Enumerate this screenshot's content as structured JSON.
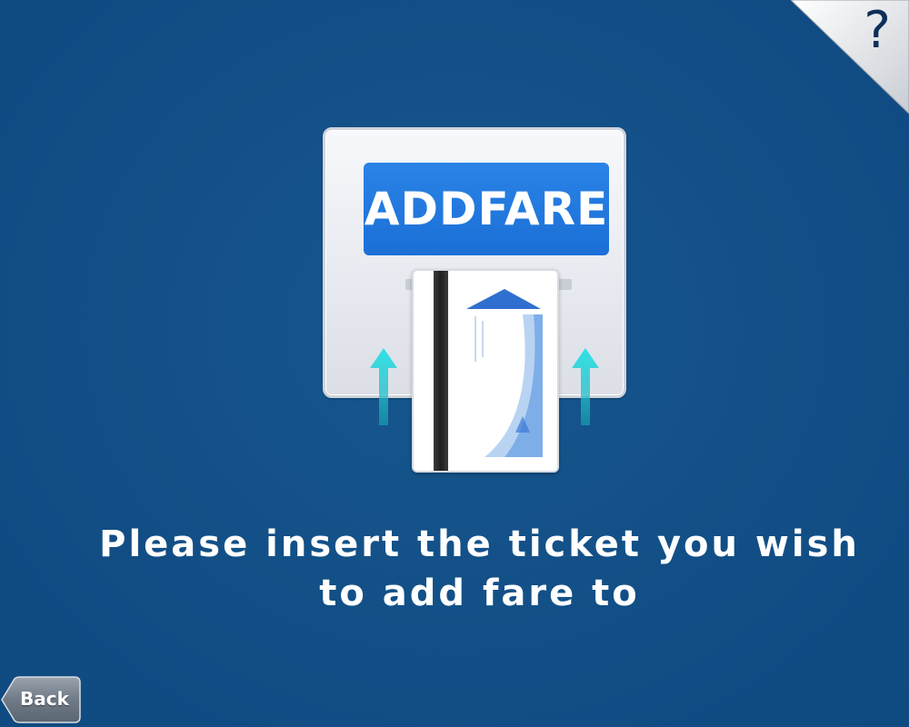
{
  "help": {
    "glyph": "?",
    "icon": "question-mark-icon"
  },
  "illustration": {
    "machine_label": "ADDFARE",
    "arrow_color": "#1fd1d6",
    "label_color": "#1b6fd6",
    "icons": [
      "ticket-card-icon",
      "up-arrow-icon"
    ]
  },
  "instruction": {
    "line1": "Please insert the ticket you wish",
    "line2": "to add fare to"
  },
  "back": {
    "label": "Back"
  },
  "colors": {
    "background": "#124f86",
    "text": "#ffffff"
  }
}
